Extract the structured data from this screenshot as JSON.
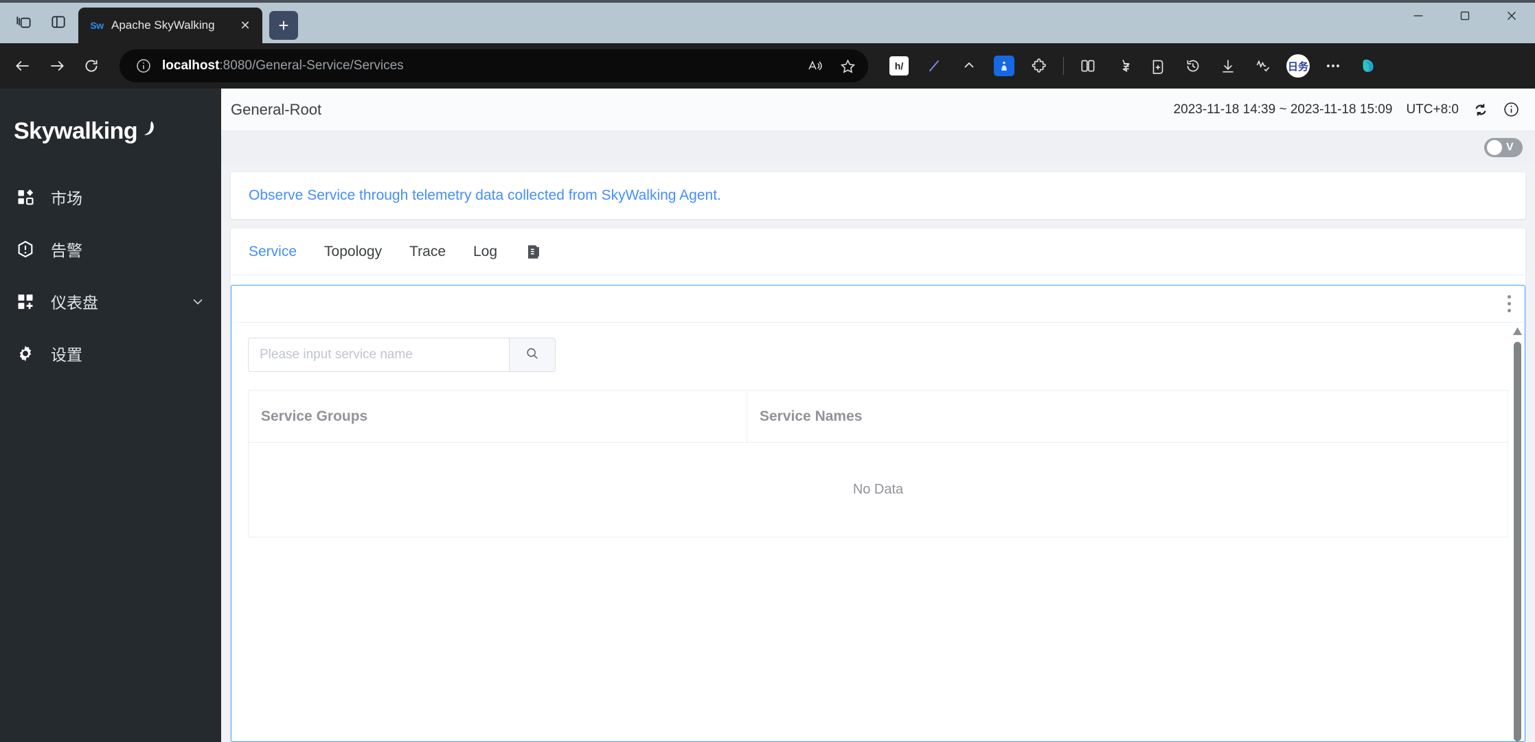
{
  "browser": {
    "left_icons": [
      {
        "name": "tab-groups-icon",
        "label": "Tab groups"
      },
      {
        "name": "split-screen-icon",
        "label": "Split screen"
      }
    ],
    "tab": {
      "title": "Apache SkyWalking",
      "favicon_text": "Sw",
      "close_label": "✕"
    },
    "new_tab_label": "+",
    "window_controls": {
      "minimize": "—",
      "maximize": "□",
      "close": "✕"
    },
    "nav": {
      "back": "Back",
      "forward": "Forward",
      "reload": "Refresh"
    },
    "address": {
      "host": "localhost",
      "path": ":8080/General-Service/Services",
      "full_url": "localhost:8080/General-Service/Services",
      "info_icon": "site-information-icon"
    },
    "omnibox_right_icons": [
      "read-aloud-icon",
      "favorite-star-icon"
    ],
    "toolbar_icons": [
      "hypothesis-extension-icon",
      "pen-extension-icon",
      "chevron-up-icon",
      "blue-extension-icon",
      "extensions-puzzle-icon",
      "split-screen-icon",
      "collections-icon",
      "add-to-collection-icon",
      "history-icon",
      "downloads-icon",
      "browser-essentials-icon",
      "oval-extension-icon",
      "more-settings-icon",
      "copilot-icon"
    ],
    "extension_badges": {
      "hypothesis": "h/",
      "oval": "日务"
    }
  },
  "sidebar": {
    "brand": "Skywalking",
    "items": [
      {
        "label": "市场",
        "icon": "marketplace-icon",
        "has_chevron": false
      },
      {
        "label": "告警",
        "icon": "alarm-icon",
        "has_chevron": false
      },
      {
        "label": "仪表盘",
        "icon": "dashboard-icon",
        "has_chevron": true
      },
      {
        "label": "设置",
        "icon": "settings-gear-icon",
        "has_chevron": false
      }
    ]
  },
  "page_header": {
    "title": "General-Root",
    "date_range": "2023-11-18 14:39 ~ 2023-11-18 15:09",
    "timezone": "UTC+8:0",
    "reload_icon": "auto-refresh-icon",
    "info_icon": "info-circle-icon"
  },
  "toggle": {
    "label": "V",
    "state": "off"
  },
  "banner": {
    "text": "Observe Service through telemetry data collected from SkyWalking Agent."
  },
  "tabs": [
    {
      "label": "Service",
      "active": true
    },
    {
      "label": "Topology",
      "active": false
    },
    {
      "label": "Trace",
      "active": false
    },
    {
      "label": "Log",
      "active": false
    }
  ],
  "tab_extra_icon": "copy-documents-icon",
  "panel": {
    "menu_icon": "kebab-menu-icon",
    "search": {
      "placeholder": "Please input service name",
      "value": "",
      "button_icon": "search-icon"
    },
    "table": {
      "columns": [
        "Service Groups",
        "Service Names"
      ],
      "rows": [],
      "empty_text": "No Data"
    },
    "scrollbar": {
      "arrow_up": "scroll-up-arrow-icon"
    }
  },
  "colors": {
    "accent_blue": "#448dfe",
    "panel_border": "#409eff",
    "sidebar_bg": "#252a2f",
    "tabstrip_bg": "#b6c7d1",
    "chrome_bg": "#1f1f1f"
  }
}
